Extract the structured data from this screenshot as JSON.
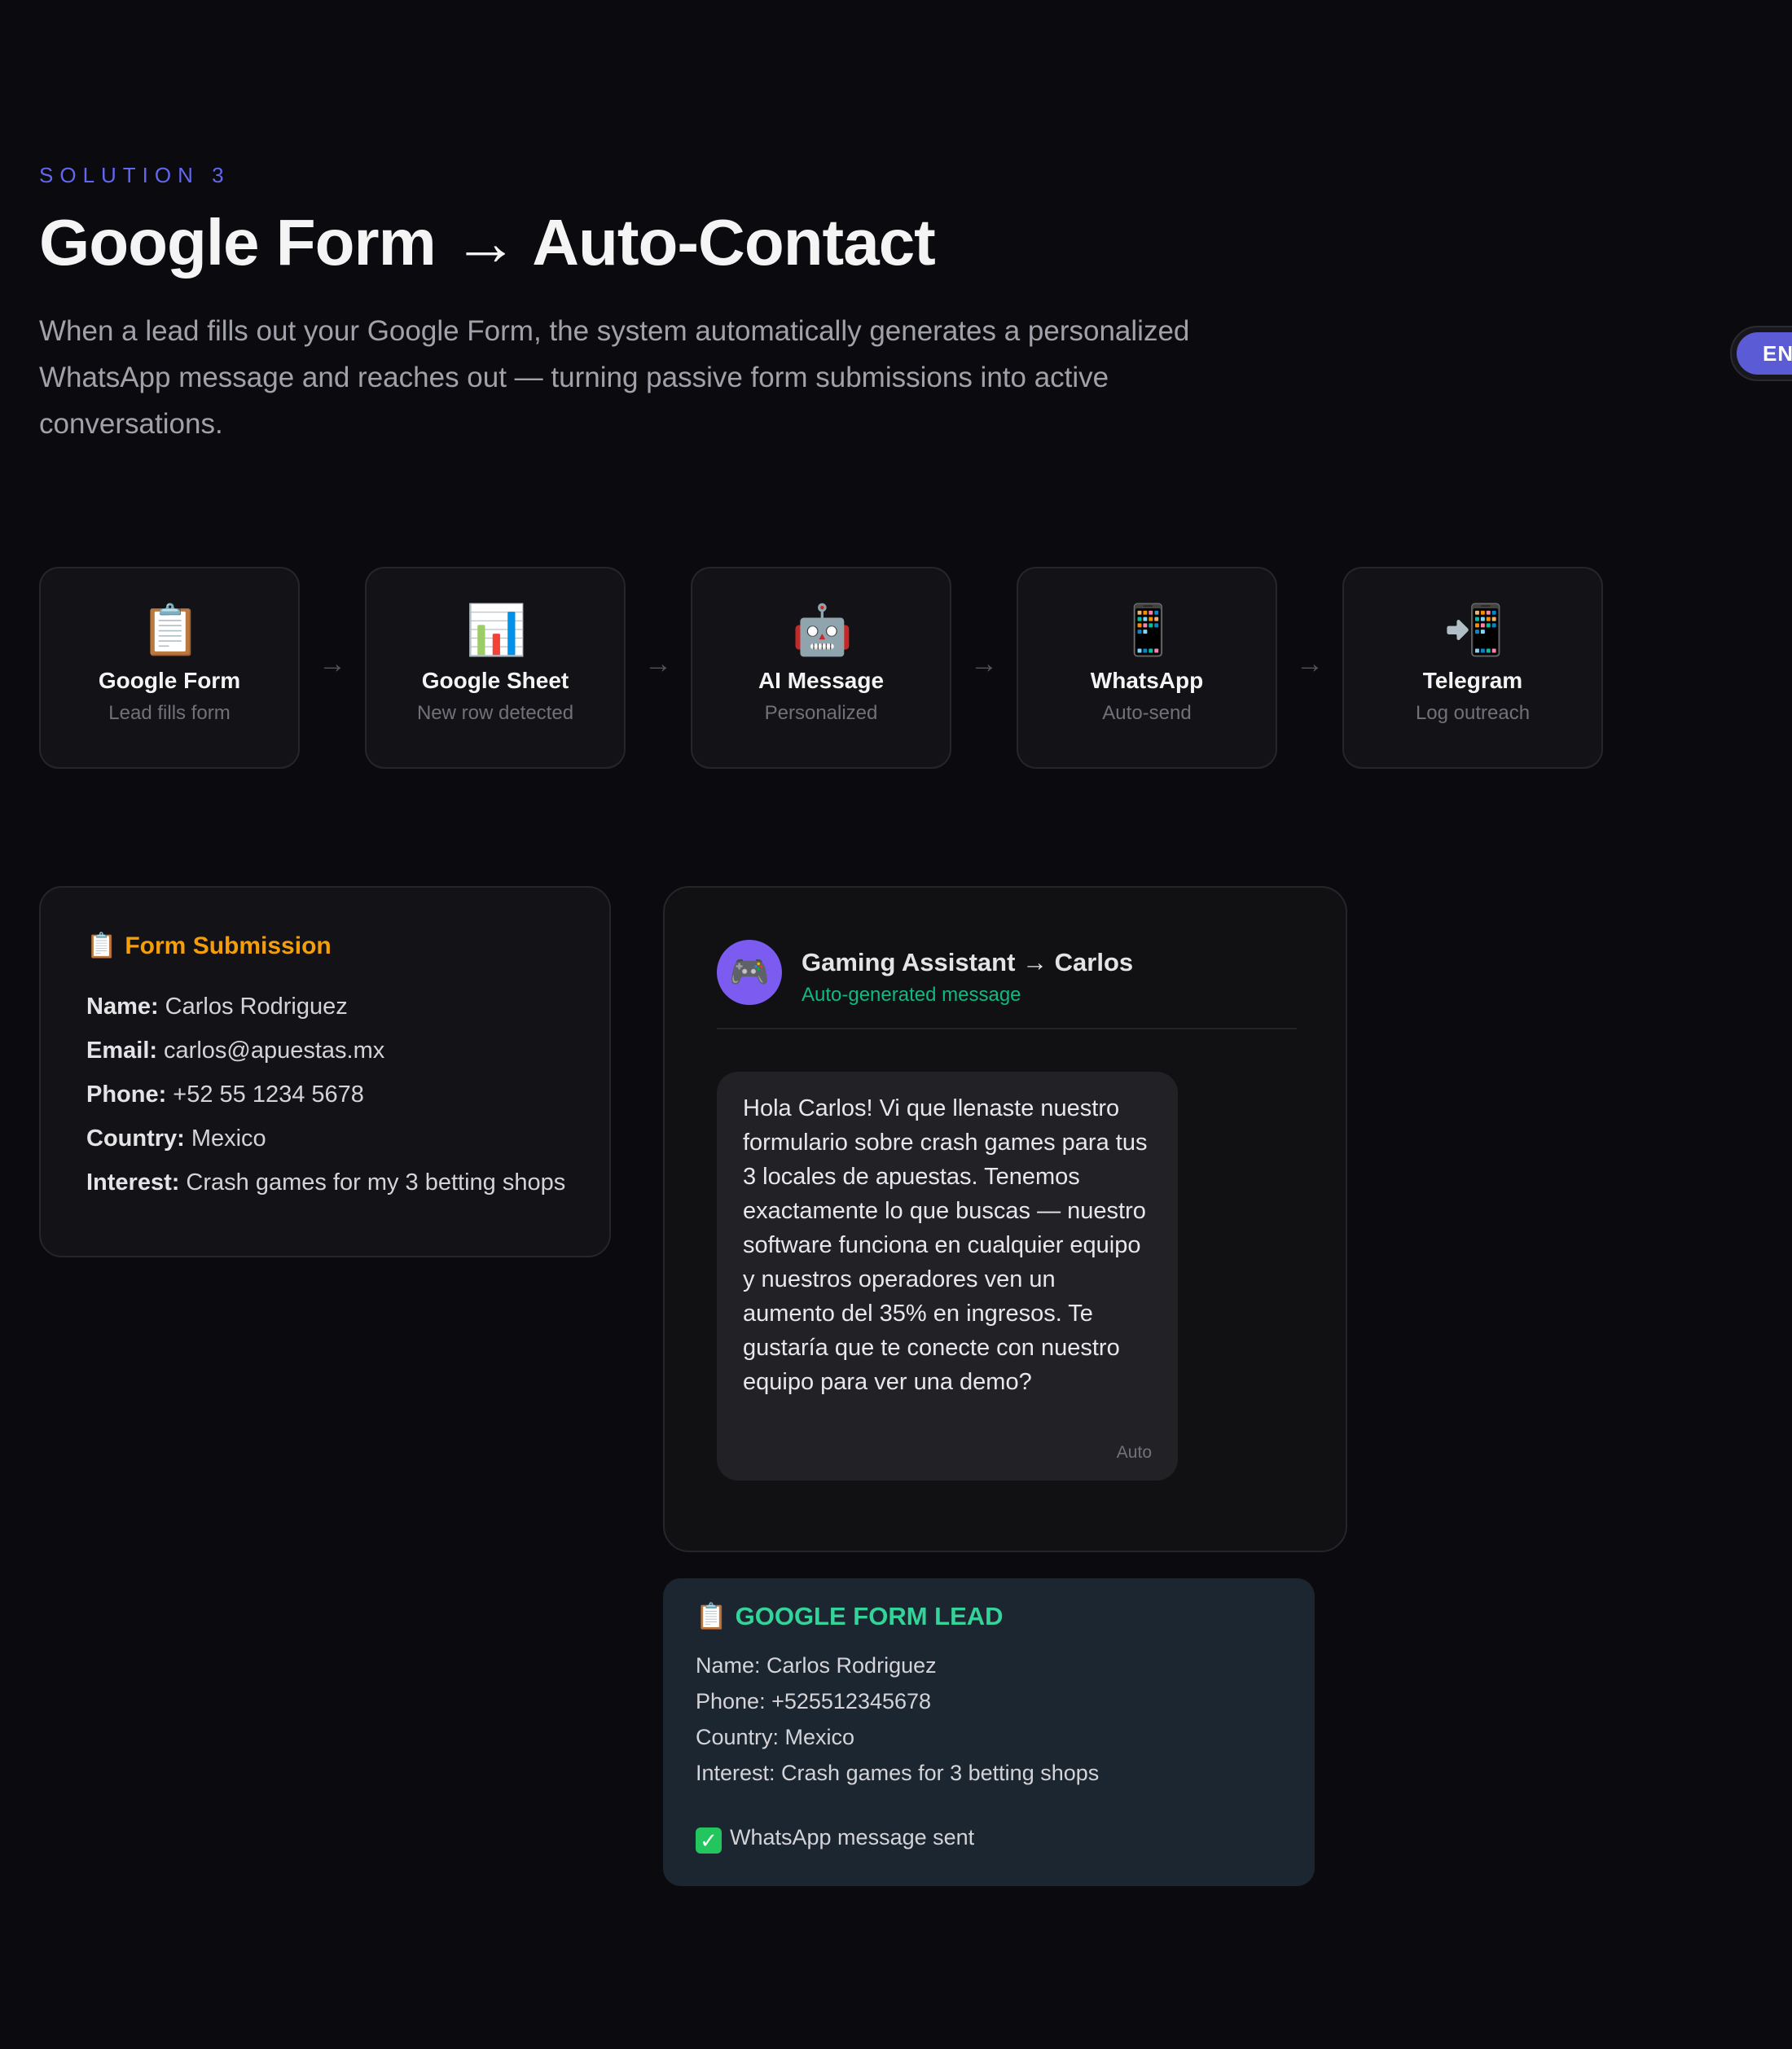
{
  "section": {
    "eyebrow": "SOLUTION 3",
    "title": "Google Form → Auto-Contact",
    "description": "When a lead fills out your Google Form, the system automatically generates a personalized WhatsApp message and reaches out — turning passive form submissions into active conversations."
  },
  "lang_toggle": {
    "active": "EN"
  },
  "flow": {
    "arrow": "→",
    "steps": [
      {
        "icon": "clipboard-icon",
        "glyph": "📋",
        "label": "Google Form",
        "sub": "Lead fills form"
      },
      {
        "icon": "bar-chart-icon",
        "glyph": "📊",
        "label": "Google Sheet",
        "sub": "New row detected"
      },
      {
        "icon": "robot-icon",
        "glyph": "🤖",
        "label": "AI Message",
        "sub": "Personalized"
      },
      {
        "icon": "mobile-phone-icon",
        "glyph": "📱",
        "label": "WhatsApp",
        "sub": "Auto-send"
      },
      {
        "icon": "mobile-arrow-icon",
        "glyph": "📲",
        "label": "Telegram",
        "sub": "Log outreach"
      }
    ]
  },
  "form_submission": {
    "icon": "📋",
    "title": "Form Submission",
    "fields": [
      {
        "key": "Name:",
        "value": "Carlos Rodriguez"
      },
      {
        "key": "Email:",
        "value": "carlos@apuestas.mx"
      },
      {
        "key": "Phone:",
        "value": "+52 55 1234 5678"
      },
      {
        "key": "Country:",
        "value": "Mexico"
      },
      {
        "key": "Interest:",
        "value": "Crash games for my 3 betting shops"
      }
    ]
  },
  "chat": {
    "avatar_icon": "🎮",
    "name": "Gaming Assistant → Carlos",
    "status": "Auto-generated message",
    "message": "Hola Carlos! Vi que llenaste nuestro formulario sobre crash games para tus 3 locales de apuestas. Tenemos exactamente lo que buscas — nuestro software funciona en cualquier equipo y nuestros operadores ven un aumento del 35% en ingresos. Te gustaría que te conecte con nuestro equipo para ver una demo?",
    "meta": "Auto"
  },
  "lead_log": {
    "icon": "📋",
    "title": "GOOGLE FORM LEAD",
    "lines": [
      "Name: Carlos Rodriguez",
      "Phone: +525512345678",
      "Country: Mexico",
      "Interest: Crash games for 3 betting shops"
    ],
    "check_glyph": "✓",
    "sent": "WhatsApp message sent"
  },
  "colors": {
    "background": "#0b0b0f",
    "accent": "#6366f1",
    "form_title": "#f59e0b",
    "status_green": "#10b981",
    "lead_title": "#34d399"
  }
}
